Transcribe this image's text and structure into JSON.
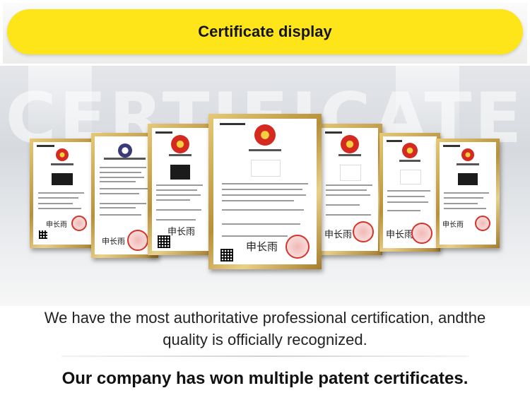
{
  "header": {
    "title": "Certificate display"
  },
  "hero": {
    "watermark": "CERTIFICATE"
  },
  "certificates": {
    "count": 7,
    "seal_color": "#d8322a",
    "frame_color": "#c9a44e",
    "signature_text": "申长雨"
  },
  "captions": {
    "line1a": "We have the most authoritative professional certification, andthe",
    "line1b": "quality is officially recognized.",
    "line2": "Our company has won multiple patent certificates."
  },
  "colors": {
    "banner_yellow": "#fde51a"
  }
}
